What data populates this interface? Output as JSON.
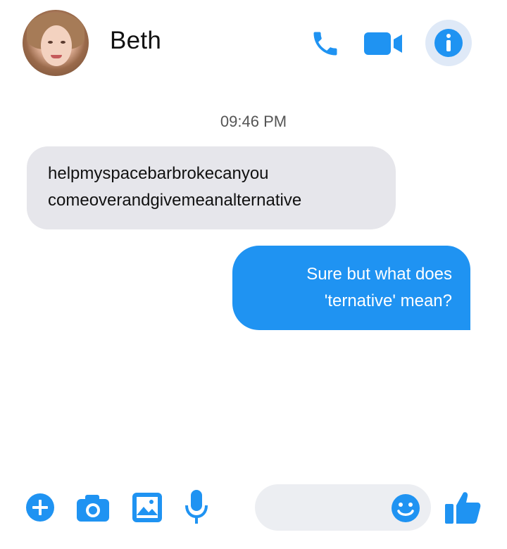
{
  "header": {
    "contact_name": "Beth",
    "icons": [
      "avatar",
      "phone-icon",
      "video-camera-icon",
      "info-icon"
    ]
  },
  "conversation": {
    "timestamp": "09:46 PM",
    "messages": [
      {
        "direction": "incoming",
        "lines": [
          "helpmyspacebarbrokecanyou",
          "comeoverandgivemeanalternative"
        ]
      },
      {
        "direction": "outgoing",
        "lines": [
          "Sure but what does",
          "'ternative' mean?"
        ]
      }
    ]
  },
  "composer": {
    "icons": [
      "plus-icon",
      "camera-icon",
      "gallery-icon",
      "microphone-icon",
      "emoji-icon",
      "thumbs-up-icon"
    ]
  },
  "colors": {
    "accent": "#1f93f2",
    "incoming_bubble": "#e6e6eb",
    "info_button_bg": "#dfe9f7"
  }
}
